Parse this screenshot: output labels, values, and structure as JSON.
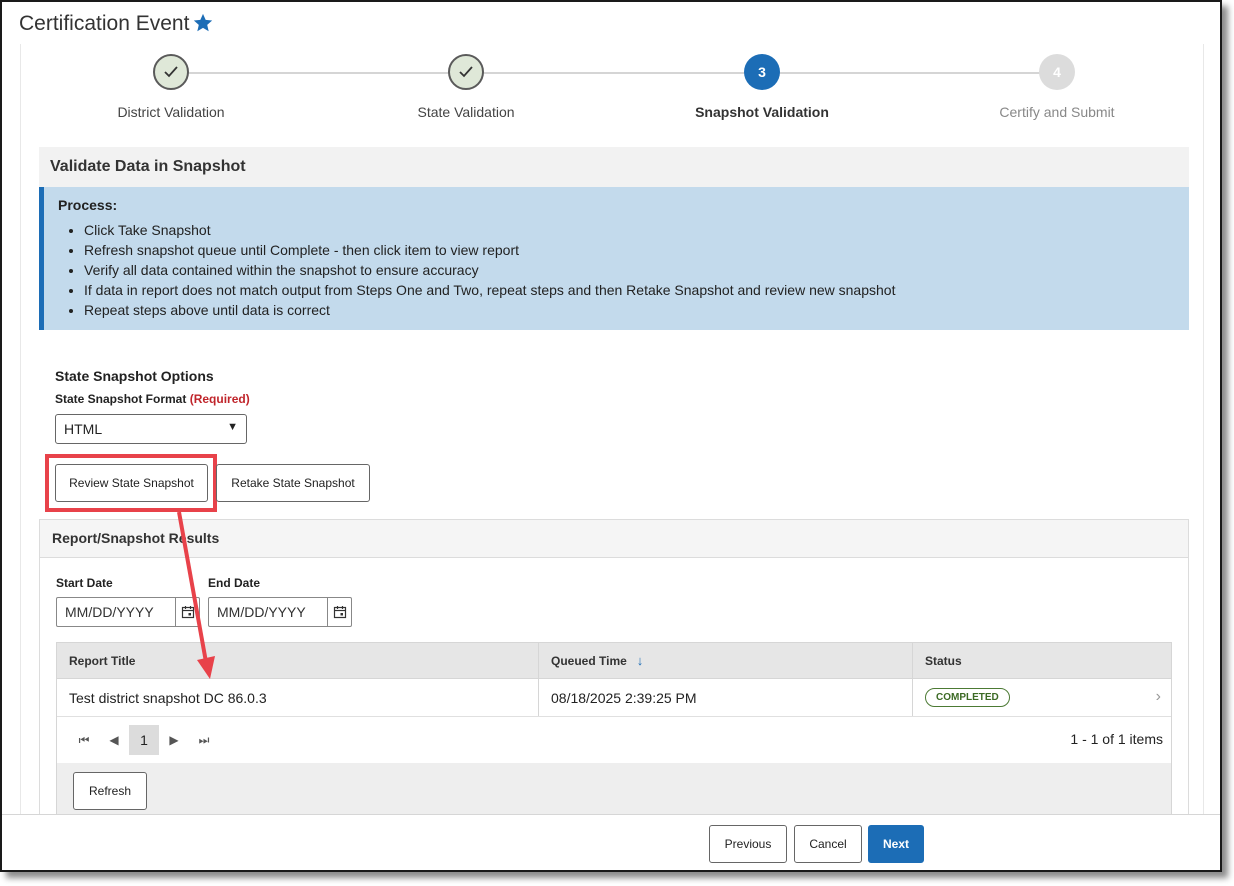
{
  "page_title": "Certification Event",
  "steps": [
    {
      "number": "✓",
      "label": "District Validation",
      "state": "done"
    },
    {
      "number": "✓",
      "label": "State Validation",
      "state": "done"
    },
    {
      "number": "3",
      "label": "Snapshot Validation",
      "state": "active"
    },
    {
      "number": "4",
      "label": "Certify and Submit",
      "state": "todo"
    }
  ],
  "section_title": "Validate Data in Snapshot",
  "process": {
    "title": "Process:",
    "items": [
      "Click Take Snapshot",
      "Refresh snapshot queue until Complete - then click item to view report",
      "Verify all data contained within the snapshot to ensure accuracy",
      "If data in report does not match output from Steps One and Two, repeat steps and then Retake Snapshot and review new snapshot",
      "Repeat steps above until data is correct"
    ]
  },
  "options": {
    "title": "State Snapshot Options",
    "format_label": "State Snapshot Format",
    "format_required": "(Required)",
    "format_value": "HTML",
    "review_button": "Review State Snapshot",
    "retake_button": "Retake State Snapshot"
  },
  "results": {
    "title": "Report/Snapshot Results",
    "start_label": "Start Date",
    "start_placeholder": "MM/DD/YYYY",
    "end_label": "End Date",
    "end_placeholder": "MM/DD/YYYY",
    "columns": [
      "Report Title",
      "Queued Time",
      "Status"
    ],
    "sort_indicator": "↓",
    "rows": [
      {
        "title": "Test district snapshot DC 86.0.3",
        "queued": "08/18/2025 2:39:25 PM",
        "status": "COMPLETED"
      }
    ],
    "current_page": "1",
    "items_count": "1 - 1 of 1 items",
    "refresh_button": "Refresh"
  },
  "footer": {
    "previous": "Previous",
    "cancel": "Cancel",
    "next": "Next"
  },
  "colors": {
    "accent": "#1c6db6",
    "info_bg": "#c3daec",
    "highlight": "#e8424a",
    "status_green": "#3c6a24"
  },
  "icons": [
    "star-icon",
    "checkmark-icon",
    "caret-down-icon",
    "calendar-icon",
    "sort-down-icon",
    "chevron-right-icon",
    "first-page-icon",
    "prev-page-icon",
    "next-page-icon",
    "last-page-icon"
  ]
}
